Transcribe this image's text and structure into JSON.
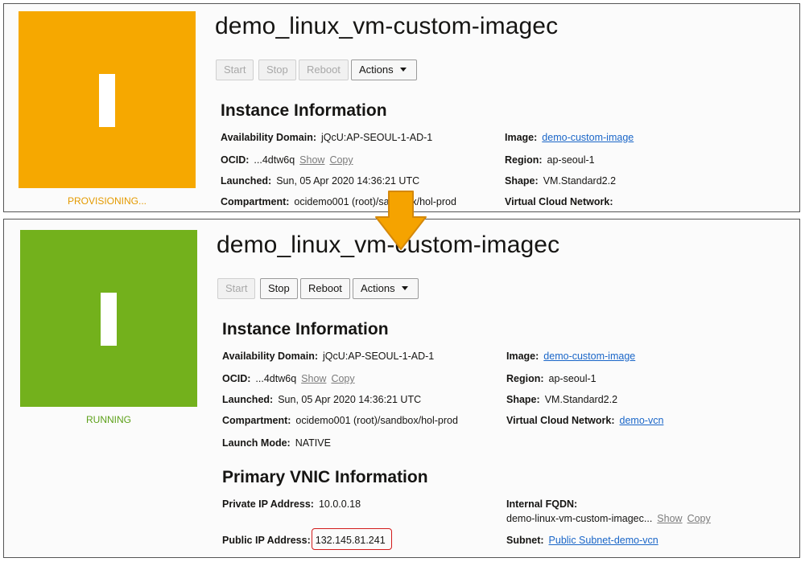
{
  "before": {
    "instance_name": "demo_linux_vm-custom-imagec",
    "status_label": "PROVISIONING...",
    "tile_color": "#f6a800",
    "status_color": "#e49a00",
    "buttons": {
      "start": "Start",
      "stop": "Stop",
      "reboot": "Reboot",
      "actions": "Actions"
    },
    "instance_info": {
      "heading": "Instance Information",
      "availability_domain_label": "Availability Domain:",
      "availability_domain_value": "jQcU:AP-SEOUL-1-AD-1",
      "ocid_label": "OCID:",
      "ocid_value": "...4dtw6q",
      "show": "Show",
      "copy": "Copy",
      "launched_label": "Launched:",
      "launched_value": "Sun, 05 Apr 2020 14:36:21 UTC",
      "compartment_label": "Compartment:",
      "compartment_value": "ocidemo001 (root)/sandbox/hol-prod",
      "image_label": "Image:",
      "image_value": "demo-custom-image",
      "region_label": "Region:",
      "region_value": "ap-seoul-1",
      "shape_label": "Shape:",
      "shape_value": "VM.Standard2.2",
      "vcn_label": "Virtual Cloud Network:"
    }
  },
  "after": {
    "instance_name": "demo_linux_vm-custom-imagec",
    "status_label": "RUNNING",
    "tile_color": "#73b11c",
    "status_color": "#5ea11b",
    "buttons": {
      "start": "Start",
      "stop": "Stop",
      "reboot": "Reboot",
      "actions": "Actions"
    },
    "instance_info": {
      "heading": "Instance Information",
      "availability_domain_label": "Availability Domain:",
      "availability_domain_value": "jQcU:AP-SEOUL-1-AD-1",
      "ocid_label": "OCID:",
      "ocid_value": "...4dtw6q",
      "show": "Show",
      "copy": "Copy",
      "launched_label": "Launched:",
      "launched_value": "Sun, 05 Apr 2020 14:36:21 UTC",
      "compartment_label": "Compartment:",
      "compartment_value": "ocidemo001 (root)/sandbox/hol-prod",
      "launch_mode_label": "Launch Mode:",
      "launch_mode_value": "NATIVE",
      "image_label": "Image:",
      "image_value": "demo-custom-image",
      "region_label": "Region:",
      "region_value": "ap-seoul-1",
      "shape_label": "Shape:",
      "shape_value": "VM.Standard2.2",
      "vcn_label": "Virtual Cloud Network:",
      "vcn_value": "demo-vcn"
    },
    "vnic_info": {
      "heading": "Primary VNIC Information",
      "private_ip_label": "Private IP Address:",
      "private_ip_value": "10.0.0.18",
      "public_ip_label": "Public IP Address:",
      "public_ip_value": "132.145.81.241",
      "fqdn_label": "Internal FQDN:",
      "fqdn_value": "demo-linux-vm-custom-imagec...",
      "show": "Show",
      "copy": "Copy",
      "subnet_label": "Subnet:",
      "subnet_value": "Public Subnet-demo-vcn"
    }
  },
  "arrow_color": "#f5a300",
  "highlight_color": "#d21b1b"
}
